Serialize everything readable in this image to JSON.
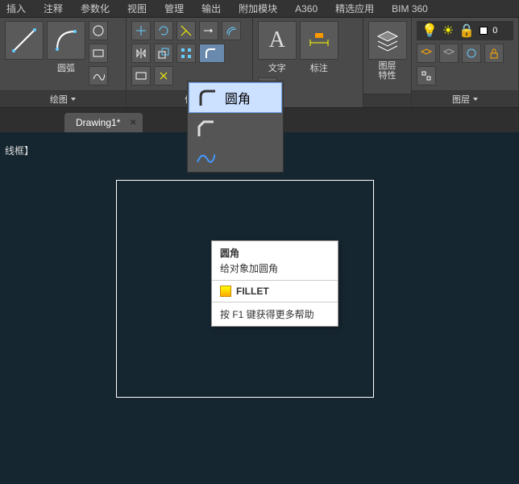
{
  "menu": {
    "items": [
      "插入",
      "注释",
      "参数化",
      "视图",
      "管理",
      "输出",
      "附加模块",
      "A360",
      "精选应用",
      "BIM 360"
    ]
  },
  "ribbon": {
    "draw": {
      "title": "绘图",
      "arc": "圆弧"
    },
    "modify": {
      "title": "修"
    },
    "annot": {
      "title": "标注",
      "text": "文字"
    },
    "layers": {
      "title": "图层",
      "props": "图层\n特性",
      "panel2": "图层"
    }
  },
  "tabs": [
    {
      "name": "Drawing1*"
    }
  ],
  "canvas": {
    "hint": "线框】"
  },
  "flyout": {
    "selected": "圆角",
    "items": [
      {
        "label": "圆角"
      },
      {
        "label": ""
      }
    ]
  },
  "tooltip": {
    "title": "圆角",
    "desc": "给对象加圆角",
    "command": "FILLET",
    "help": "按 F1 键获得更多帮助"
  }
}
